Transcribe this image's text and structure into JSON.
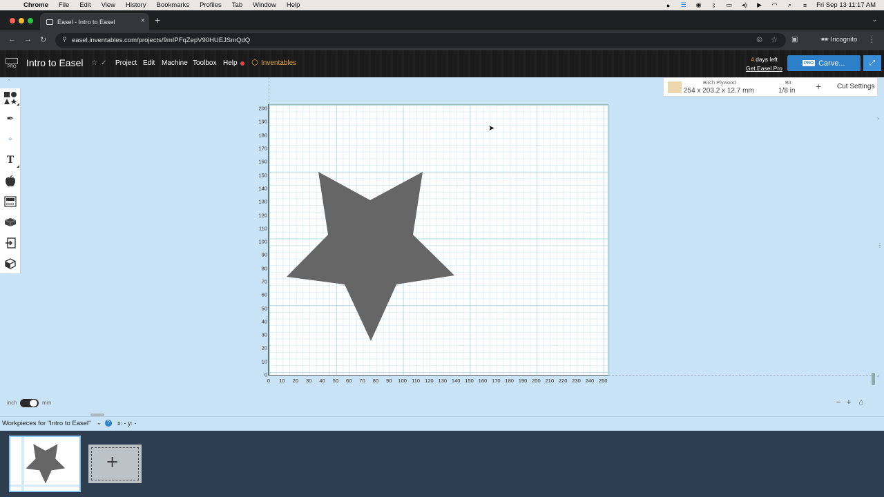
{
  "menubar": {
    "app_name": "Chrome",
    "items": [
      "File",
      "Edit",
      "View",
      "History",
      "Bookmarks",
      "Profiles",
      "Tab",
      "Window",
      "Help"
    ],
    "clock": "Fri Sep 13  11:17 AM"
  },
  "browser": {
    "tab_title": "Easel - Intro to Easel",
    "url": "easel.inventables.com/projects/9mIPFqZepV90HUEJSmQdQ",
    "incognito_label": "Incognito"
  },
  "header": {
    "logo_text": "PRO",
    "project_title": "Intro to Easel",
    "menus": [
      "Project",
      "Edit",
      "Machine",
      "Toolbox",
      "Help"
    ],
    "inventables_label": "Inventables",
    "days_left_num": "4",
    "days_left_text": " days left",
    "get_pro": "Get Easel Pro",
    "pro_badge": "PRO",
    "carve_label": "Carve..."
  },
  "material": {
    "name": "Birch Plywood",
    "dims": "254 x 203.2 x 12.7 mm",
    "swatch_color": "#ecd7ae"
  },
  "bit": {
    "label": "Bit",
    "value": "1/8 in"
  },
  "cut_settings_label": "Cut Settings",
  "canvas": {
    "x_ticks": [
      "0",
      "10",
      "20",
      "30",
      "40",
      "50",
      "60",
      "70",
      "80",
      "90",
      "100",
      "110",
      "120",
      "130",
      "140",
      "150",
      "160",
      "170",
      "180",
      "190",
      "200",
      "210",
      "220",
      "230",
      "240",
      "250"
    ],
    "y_ticks": [
      "0",
      "10",
      "20",
      "30",
      "40",
      "50",
      "60",
      "70",
      "80",
      "90",
      "100",
      "110",
      "120",
      "130",
      "140",
      "150",
      "160",
      "170",
      "180",
      "190",
      "200"
    ],
    "shape": "star",
    "shape_color": "#666666"
  },
  "units": {
    "left": "inch",
    "right": "mm",
    "selected": "mm"
  },
  "workpieces": {
    "label": "Workpieces for \"Intro to Easel\"",
    "help": "?",
    "coords": "x: -  y: -"
  },
  "colors": {
    "accent": "#2d7fc8",
    "workspace_bg": "#c8e3f5",
    "tray_bg": "#2d3e50"
  }
}
